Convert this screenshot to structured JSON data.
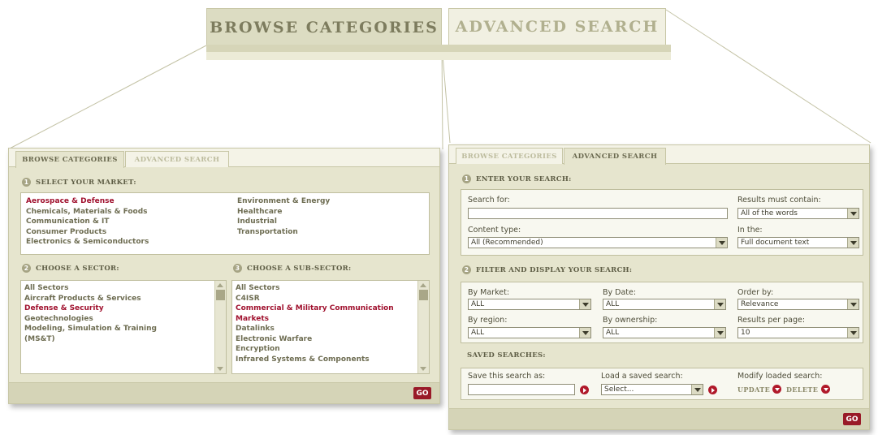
{
  "big_tabs": {
    "browse": "BROWSE CATEGORIES",
    "advanced": "ADVANCED SEARCH"
  },
  "browse_panel": {
    "tabs": {
      "browse": "BROWSE CATEGORIES",
      "advanced": "ADVANCED SEARCH"
    },
    "market": {
      "heading": "SELECT YOUR MARKET:",
      "number": "1",
      "col1": [
        "Aerospace & Defense",
        "Chemicals, Materials & Foods",
        "Communication & IT",
        "Consumer Products",
        "Electronics & Semiconductors"
      ],
      "col2": [
        "Environment & Energy",
        "Healthcare",
        "Industrial",
        "Transportation"
      ],
      "selected": "Aerospace & Defense"
    },
    "sector": {
      "heading": "CHOOSE A SECTOR:",
      "number": "2",
      "items": [
        "All Sectors",
        "Aircraft Products & Services",
        "Defense & Security",
        "Geotechnologies",
        "Modeling, Simulation & Training",
        "(MS&T)"
      ]
    },
    "subsector": {
      "heading": "CHOOSE A SUB-SECTOR:",
      "number": "3",
      "items": [
        "All Sectors",
        "C4ISR",
        "Commercial & Military Communication",
        "Markets",
        "Datalinks",
        "Electronic Warfare",
        "Encryption",
        "Infrared Systems & Components"
      ]
    },
    "go_label": "GO"
  },
  "advanced_panel": {
    "tabs": {
      "browse": "BROWSE CATEGORIES",
      "advanced": "ADVANCED SEARCH"
    },
    "enter": {
      "heading": "ENTER YOUR SEARCH:",
      "number": "1",
      "search_for_label": "Search for:",
      "search_for_value": "",
      "must_contain_label": "Results must contain:",
      "must_contain_value": "All of the words",
      "content_type_label": "Content type:",
      "content_type_value": "All (Recommended)",
      "in_the_label": "In the:",
      "in_the_value": "Full document text"
    },
    "filter": {
      "heading": "FILTER AND DISPLAY YOUR SEARCH:",
      "number": "2",
      "by_market_label": "By Market:",
      "by_market_value": "ALL",
      "by_date_label": "By Date:",
      "by_date_value": "ALL",
      "order_by_label": "Order by:",
      "order_by_value": "Relevance",
      "by_region_label": "By region:",
      "by_region_value": "ALL",
      "by_ownership_label": "By ownership:",
      "by_ownership_value": "ALL",
      "per_page_label": "Results per page:",
      "per_page_value": "10"
    },
    "saved": {
      "heading": "SAVED SEARCHES:",
      "save_as_label": "Save this search as:",
      "save_as_value": "",
      "load_label": "Load a saved search:",
      "load_value": "Select...",
      "modify_label": "Modify loaded search:",
      "update_label": "UPDATE",
      "delete_label": "DELETE"
    },
    "go_label": "GO"
  },
  "colors": {
    "panel_bg": "#e6e5ce",
    "selected_text": "#a0112e",
    "go_button": "#991a28",
    "accent_red": "#b0192a"
  }
}
